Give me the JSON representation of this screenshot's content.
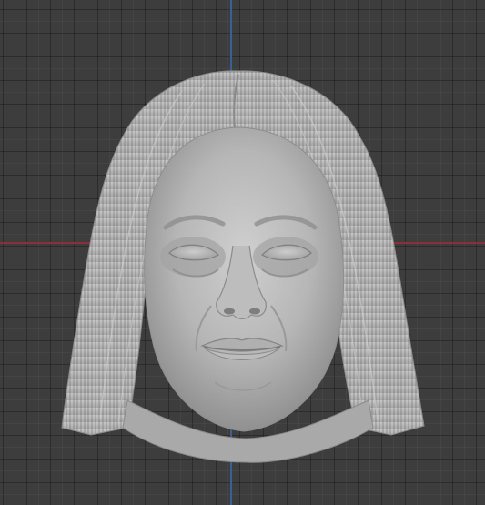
{
  "viewport": {
    "background_color": "#3d3d3d",
    "grid_color": "#2f2f2f",
    "x_axis_color": "#8e2e3d",
    "z_axis_color": "#3a5f95"
  },
  "model": {
    "kind": "sculpted-head-mesh",
    "material_color": "#b4b4b4",
    "shading": "matcap-clay"
  },
  "icons": {
    "model": "sculpted-head-icon"
  }
}
